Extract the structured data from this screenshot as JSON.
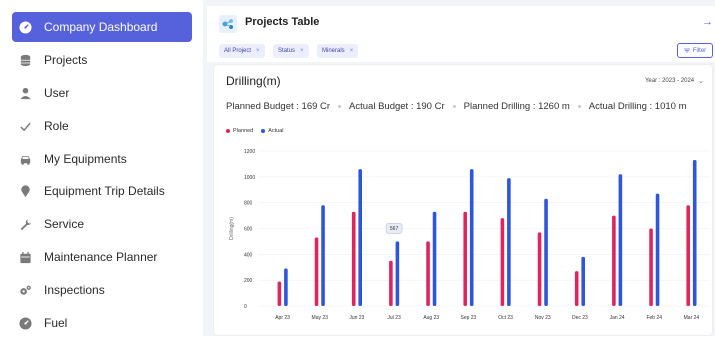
{
  "sidebar": {
    "items": [
      {
        "label": "Company Dashboard",
        "icon": "dashboard-gauge-icon",
        "active": true
      },
      {
        "label": "Projects",
        "icon": "database-icon",
        "active": false
      },
      {
        "label": "User",
        "icon": "user-icon",
        "active": false
      },
      {
        "label": "Role",
        "icon": "check-icon",
        "active": false
      },
      {
        "label": "My Equipments",
        "icon": "car-icon",
        "active": false
      },
      {
        "label": "Equipment Trip Details",
        "icon": "map-pin-icon",
        "active": false
      },
      {
        "label": "Service",
        "icon": "wrench-icon",
        "active": false
      },
      {
        "label": "Maintenance Planner",
        "icon": "calendar-icon",
        "active": false
      },
      {
        "label": "Inspections",
        "icon": "gears-icon",
        "active": false
      },
      {
        "label": "Fuel",
        "icon": "fuel-gauge-icon",
        "active": false
      }
    ]
  },
  "header": {
    "title": "Projects Table",
    "arrow": "→"
  },
  "filters": {
    "chips": [
      "All Project",
      "Status",
      "Minerals"
    ],
    "chip_remove": "×",
    "filter_button": "Filter"
  },
  "card": {
    "title": "Drilling(m)",
    "year_select": "Year : 2023 - 2024",
    "stats": {
      "planned_budget": "Planned Budget : 169 Cr",
      "actual_budget": "Actual Budget : 190 Cr",
      "planned_drilling": "Planned Drilling : 1260 m",
      "actual_drilling": "Actual Drilling : 1010 m"
    }
  },
  "colors": {
    "accent": "#5661dc",
    "planned": "#e0245e",
    "actual": "#2d56db"
  },
  "chart_data": {
    "type": "bar",
    "ylabel": "Drilling(m)",
    "ylim": [
      0,
      1200
    ],
    "yticks": [
      0,
      200,
      400,
      600,
      800,
      1000,
      1200
    ],
    "grid": true,
    "legend_placement": "top-left",
    "categories": [
      "Apr 23",
      "May 23",
      "Jun 23",
      "Jul 23",
      "Aug 23",
      "Sep 23",
      "Oct 23",
      "Nov 23",
      "Dec 23",
      "Jan 24",
      "Feb 24",
      "Mar 24"
    ],
    "series": [
      {
        "name": "Planned",
        "values": [
          190,
          530,
          730,
          350,
          500,
          730,
          680,
          570,
          270,
          700,
          600,
          780
        ]
      },
      {
        "name": "Actual",
        "values": [
          290,
          780,
          1060,
          500,
          730,
          1060,
          990,
          830,
          380,
          1020,
          870,
          1130
        ]
      }
    ],
    "tooltip": {
      "category": "Jul 23",
      "series": "Actual",
      "text": "567"
    }
  }
}
